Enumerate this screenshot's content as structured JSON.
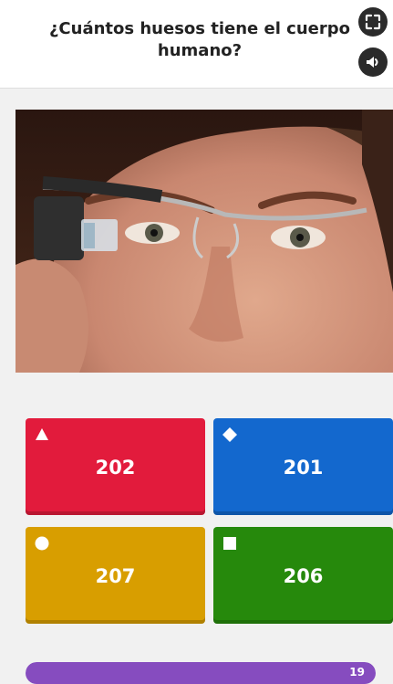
{
  "question": {
    "text": "¿Cuántos huesos tiene el cuerpo humano?"
  },
  "controls": {
    "fullscreen_icon": "fullscreen-icon",
    "sound_icon": "speaker-icon"
  },
  "answers": [
    {
      "value": "202",
      "shape": "triangle",
      "color": "#e21b3c"
    },
    {
      "value": "201",
      "shape": "diamond",
      "color": "#1368ce"
    },
    {
      "value": "207",
      "shape": "circle",
      "color": "#d89e00"
    },
    {
      "value": "206",
      "shape": "square",
      "color": "#26890c"
    }
  ],
  "timer": {
    "count": "19",
    "fraction": 1.0,
    "color": "#864cbf"
  }
}
